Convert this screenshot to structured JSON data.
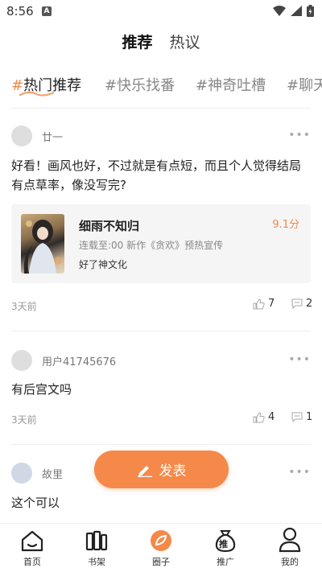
{
  "status": {
    "time": "8:56",
    "notice": "A"
  },
  "top_tabs": [
    {
      "label": "推荐",
      "active": true
    },
    {
      "label": "热议",
      "active": false
    }
  ],
  "topics": [
    {
      "label": "热门推荐",
      "active": true
    },
    {
      "label": "快乐找番",
      "active": false
    },
    {
      "label": "神奇吐槽",
      "active": false
    },
    {
      "label": "聊天",
      "active": false
    }
  ],
  "topic_hash": "#",
  "posts": [
    {
      "user": "廿一",
      "text": "好看！画风也好，不过就是有点短，而且个人觉得结局有点草率，像没写完?",
      "time": "3天前",
      "likes": "7",
      "comments": "2",
      "book": {
        "title": "细雨不知归",
        "score": "9.1分",
        "meta": "连载至:00 新作《贪欢》预热宣传",
        "tag": "好了神文化"
      }
    },
    {
      "user": "用户41745676",
      "text": "有后宫文吗",
      "time": "3天前",
      "likes": "4",
      "comments": "1"
    },
    {
      "user": "故里",
      "text": "这个可以"
    }
  ],
  "more_glyph": "•••",
  "publish_label": "发表",
  "nav": [
    {
      "label": "首页",
      "icon": "home-icon"
    },
    {
      "label": "书架",
      "icon": "bookshelf-icon"
    },
    {
      "label": "圈子",
      "icon": "circle-icon",
      "active": true
    },
    {
      "label": "推广",
      "icon": "promote-bag-icon",
      "badge": "推"
    },
    {
      "label": "我的",
      "icon": "profile-icon"
    }
  ],
  "colors": {
    "accent": "#f5894a",
    "text": "#222222",
    "muted": "#999999"
  }
}
